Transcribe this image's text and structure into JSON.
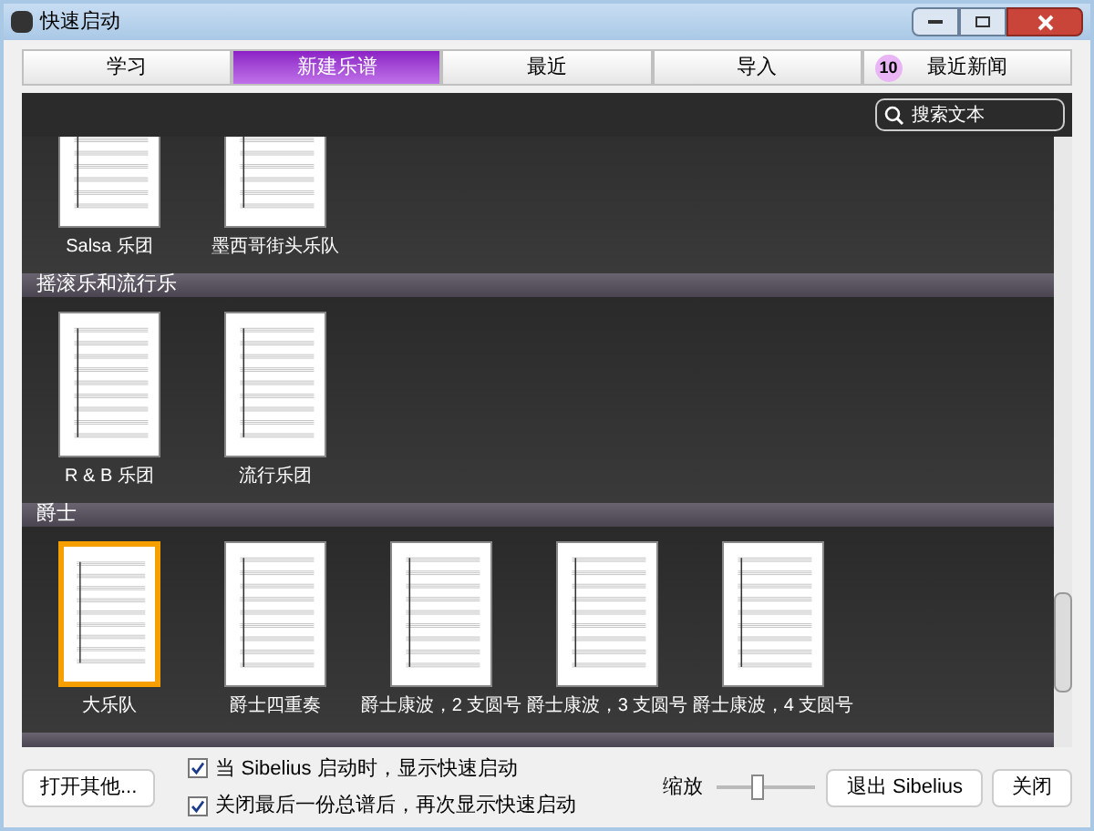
{
  "window": {
    "title": "快速启动"
  },
  "tabs": [
    {
      "label": "学习",
      "selected": false
    },
    {
      "label": "新建乐谱",
      "selected": true
    },
    {
      "label": "最近",
      "selected": false
    },
    {
      "label": "导入",
      "selected": false
    },
    {
      "label": "最近新闻",
      "selected": false,
      "badge": "10"
    }
  ],
  "search": {
    "placeholder": "搜索文本"
  },
  "sections": [
    {
      "templates": [
        {
          "label": "Salsa 乐团",
          "selected": false
        },
        {
          "label": "墨西哥街头乐队",
          "selected": false
        }
      ]
    },
    {
      "header": "摇滚乐和流行乐",
      "templates": [
        {
          "label": "R & B 乐团",
          "selected": false
        },
        {
          "label": "流行乐团",
          "selected": false
        }
      ]
    },
    {
      "header": "爵士",
      "templates": [
        {
          "label": "大乐队",
          "selected": true
        },
        {
          "label": "爵士四重奏",
          "selected": false
        },
        {
          "label": "爵士康波，2 支圆号",
          "selected": false
        },
        {
          "label": "爵士康波，3 支圆号",
          "selected": false
        },
        {
          "label": "爵士康波，4 支圆号",
          "selected": false
        }
      ]
    }
  ],
  "footer": {
    "open_button": "打开其他...",
    "options": [
      {
        "label": "当 Sibelius 启动时，显示快速启动",
        "checked": true
      },
      {
        "label": "关闭最后一份总谱后，再次显示快速启动",
        "checked": true
      }
    ],
    "zoom": {
      "label": "缩放",
      "level": 0.4
    },
    "buttons": [
      "退出 Sibelius",
      "关闭"
    ]
  }
}
